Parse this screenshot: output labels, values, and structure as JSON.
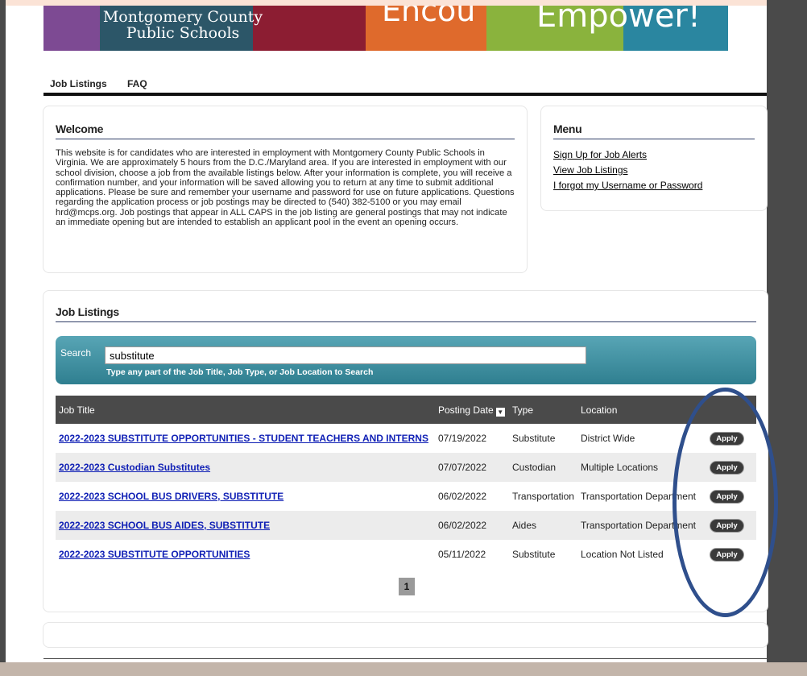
{
  "banner": {
    "district_line1": "Montgomery County",
    "district_line2": "Public Schools",
    "slogan_left": "Encou",
    "slogan_right": "Empower!"
  },
  "nav": {
    "items": [
      "Job Listings",
      "FAQ"
    ]
  },
  "welcome": {
    "title": "Welcome",
    "body": "This website is for candidates who are interested in employment with Montgomery County Public Schools in Virginia. We are approximately 5 hours from the D.C./Maryland area. If you are interested in employment with our school division, choose a job from the available listings below. After your information is complete, you will receive a confirmation number, and your information will be saved allowing you to return at any time to submit additional applications. Please be sure and remember your username and password for use on future applications. Questions regarding the application process or job postings may be directed to (540) 382-5100 or you may email hrd@mcps.org. Job postings that appear in ALL CAPS in the job listing are general postings that may not indicate an immediate opening but are intended to establish an applicant pool in the event an opening occurs."
  },
  "menu": {
    "title": "Menu",
    "links": [
      "Sign Up for Job Alerts",
      "View Job Listings",
      "I forgot my Username or Password"
    ]
  },
  "listings": {
    "title": "Job Listings",
    "search": {
      "label": "Search",
      "value": "substitute",
      "hint": "Type any part of the Job Title, Job Type, or Job Location to Search"
    },
    "columns": {
      "title": "Job Title",
      "date": "Posting Date",
      "type": "Type",
      "location": "Location"
    },
    "sort_icon": "sort-desc-icon",
    "rows": [
      {
        "title": "2022-2023 SUBSTITUTE OPPORTUNITIES - STUDENT TEACHERS AND INTERNS",
        "date": "07/19/2022",
        "type": "Substitute",
        "location": "District Wide",
        "action": "Apply"
      },
      {
        "title": "2022-2023 Custodian Substitutes",
        "date": "07/07/2022",
        "type": "Custodian",
        "location": "Multiple Locations",
        "action": "Apply"
      },
      {
        "title": "2022-2023 SCHOOL BUS DRIVERS, SUBSTITUTE",
        "date": "06/02/2022",
        "type": "Transportation",
        "location": "Transportation Department",
        "action": "Apply"
      },
      {
        "title": "2022-2023 SCHOOL BUS AIDES, SUBSTITUTE",
        "date": "06/02/2022",
        "type": "Aides",
        "location": "Transportation Department",
        "action": "Apply"
      },
      {
        "title": "2022-2023 SUBSTITUTE OPPORTUNITIES",
        "date": "05/11/2022",
        "type": "Substitute",
        "location": "Location Not Listed",
        "action": "Apply"
      }
    ],
    "page": "1"
  },
  "colors": {
    "link": "#0f1fb5",
    "header_bg": "#4a4a4a",
    "search_bg": "#3b8c9c",
    "annotation": "#2f4f8c"
  }
}
